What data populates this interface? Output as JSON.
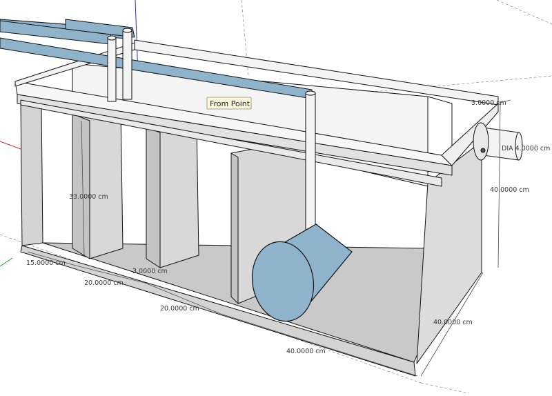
{
  "colors": {
    "background": "#ffffff",
    "face_light": "#f4f4f4",
    "face_mid": "#d8d8d8",
    "face_dark": "#c6c6c6",
    "pipe_blue": "#8eb3cb",
    "edge": "#111111",
    "dimension_line": "#4a4a4a",
    "axis_red": "#d02a2a",
    "axis_green": "#2aa02a",
    "axis_blue": "#2a2ad0",
    "tooltip_bg": "#fbf7dc"
  },
  "tooltip": {
    "text": "From Point"
  },
  "dimensions": {
    "top_thickness": "3.0000 cm",
    "pipe_dia": "DIA 4.0000 cm",
    "height_right": "40.0000 cm",
    "height_inner": "33.0000 cm",
    "front_15": "15.0000 cm",
    "front_20a": "20.0000 cm",
    "front_20b": "20.0000 cm",
    "divider_3": "3.0000 cm",
    "front_40": "40.0000 cm",
    "depth_40": "40.0000 cm"
  }
}
